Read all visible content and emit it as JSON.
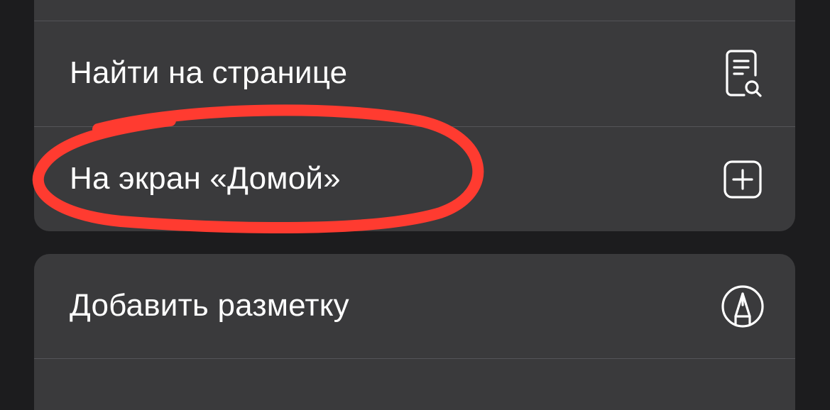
{
  "menu": {
    "group1": {
      "find_on_page": {
        "label": "Найти на странице",
        "icon": "find-on-page-icon"
      },
      "add_to_home": {
        "label": "На экран «Домой»",
        "icon": "add-square-icon"
      }
    },
    "group2": {
      "markup": {
        "label": "Добавить разметку",
        "icon": "markup-pen-icon"
      }
    }
  },
  "annotation": {
    "color": "#ff3b30",
    "target": "add_to_home"
  }
}
